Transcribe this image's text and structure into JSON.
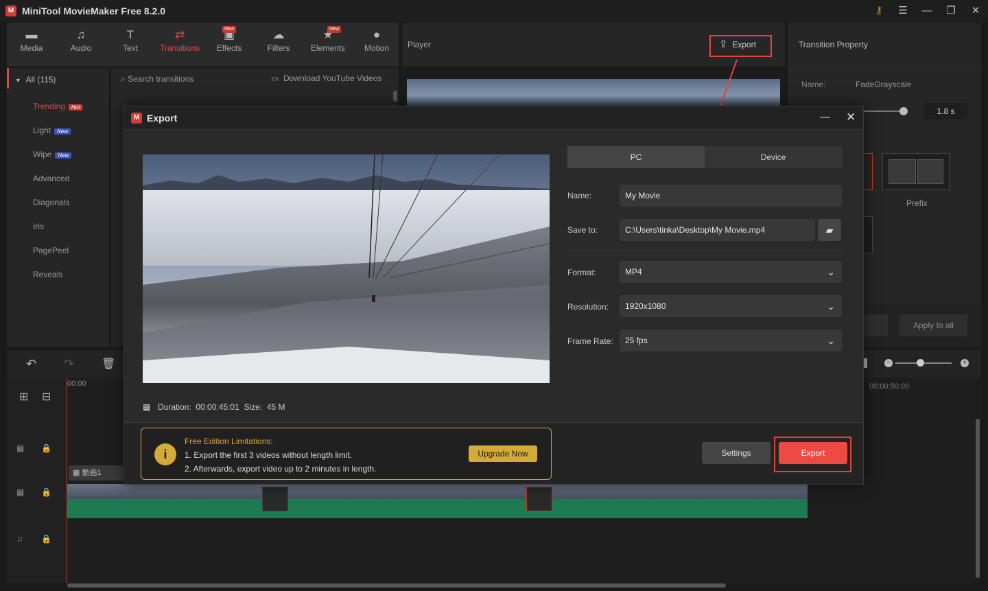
{
  "app": {
    "title": "MiniTool MovieMaker Free 8.2.0",
    "logo": "M"
  },
  "toolbar": {
    "items": [
      {
        "label": "Media",
        "icon": "folder-icon"
      },
      {
        "label": "Audio",
        "icon": "music-icon"
      },
      {
        "label": "Text",
        "icon": "text-icon"
      },
      {
        "label": "Transitions",
        "icon": "transitions-icon"
      },
      {
        "label": "Effects",
        "icon": "effects-icon",
        "new": "New"
      },
      {
        "label": "Filters",
        "icon": "filters-icon"
      },
      {
        "label": "Elements",
        "icon": "elements-icon",
        "new": "New"
      },
      {
        "label": "Motion",
        "icon": "motion-icon"
      }
    ],
    "active": "Transitions"
  },
  "categories": {
    "all_label": "All (115)",
    "items": [
      {
        "label": "Trending",
        "badge": "Hot"
      },
      {
        "label": "Light",
        "badge": "New"
      },
      {
        "label": "Wipe",
        "badge": "New"
      },
      {
        "label": "Advanced"
      },
      {
        "label": "Diagonals"
      },
      {
        "label": "Iris"
      },
      {
        "label": "PagePeel"
      },
      {
        "label": "Reveals"
      }
    ]
  },
  "search": {
    "placeholder": "Search transitions",
    "download_label": "Download YouTube Videos"
  },
  "player": {
    "label": "Player",
    "export_label": "Export"
  },
  "property": {
    "title": "Transition Property",
    "name_label": "Name:",
    "name_value": "FadeGrayscale",
    "duration": "1.8 s",
    "prefix_label": "Prefix",
    "apply_all_label": "Apply to all"
  },
  "timeline": {
    "time_start": "00:00",
    "time_mark": "00:00:50:00",
    "clip_label": "動画1"
  },
  "dialog": {
    "title": "Export",
    "tabs": [
      "PC",
      "Device"
    ],
    "active_tab": "PC",
    "name_label": "Name:",
    "name_value": "My Movie",
    "save_label": "Save to:",
    "save_value": "C:\\Users\\tinka\\Desktop\\My Movie.mp4",
    "format_label": "Format:",
    "format_value": "MP4",
    "resolution_label": "Resolution:",
    "resolution_value": "1920x1080",
    "framerate_label": "Frame Rate:",
    "framerate_value": "25 fps",
    "duration_label": "Duration:",
    "duration_value": "00:00:45:01",
    "size_label": "Size:",
    "size_value": "45 M",
    "limit_title": "Free Edition Limitations:",
    "limit_line1": "1. Export the first 3 videos without length limit.",
    "limit_line2": "2. Afterwards, export video up to 2 minutes in length.",
    "upgrade_label": "Upgrade Now",
    "settings_label": "Settings",
    "export_label": "Export"
  },
  "colors": {
    "accent": "#e0464b",
    "export_btn": "#ec4a43",
    "highlight": "#e0463f",
    "gold": "#d4aa3a"
  }
}
